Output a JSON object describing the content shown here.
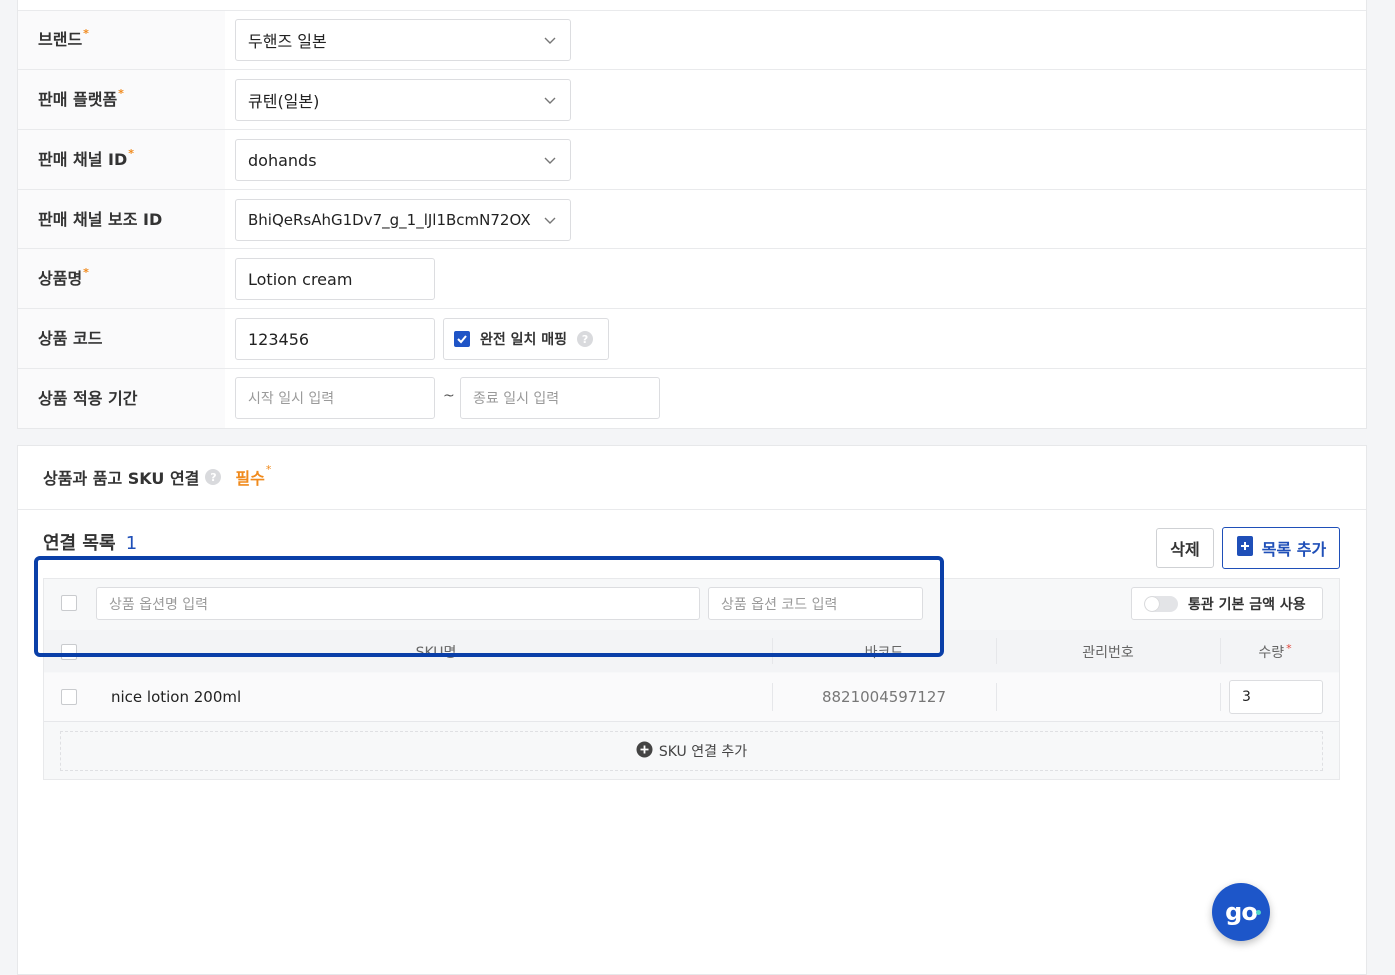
{
  "form": {
    "brand": {
      "label": "브랜드",
      "value": "두핸즈 일본"
    },
    "platform": {
      "label": "판매 플랫폼",
      "value": "큐텐(일본)"
    },
    "channel_id": {
      "label": "판매 채널 ID",
      "value": "dohands"
    },
    "channel_sub_id": {
      "label": "판매 채널 보조 ID",
      "value": "BhiQeRsAhG1Dv7_g_1_lJl1BcmN72OX"
    },
    "product_name": {
      "label": "상품명",
      "value": "Lotion cream"
    },
    "product_code": {
      "label": "상품 코드",
      "value": "123456"
    },
    "exact_match": {
      "label": "완전 일치 매핑",
      "checked": true
    },
    "period": {
      "label": "상품 적용 기간",
      "start_placeholder": "시작 일시 입력",
      "separator": "~",
      "end_placeholder": "종료 일시 입력"
    },
    "required_mark": "*"
  },
  "sku_section": {
    "title": "상품과 품고 SKU 연결",
    "required_label": "필수",
    "list_title": "연결 목록",
    "list_count": "1",
    "delete_button": "삭제",
    "add_list_button": "목록 추가",
    "option_name_placeholder": "상품 옵션명 입력",
    "option_code_placeholder": "상품 옵션 코드 입력",
    "customs_toggle_label": "통관 기본 금액 사용",
    "table": {
      "headers": {
        "sku_name": "SKU명",
        "barcode": "바코드",
        "manage_no": "관리번호",
        "qty": "수량"
      },
      "rows": [
        {
          "sku_name": "nice lotion 200ml",
          "barcode": "8821004597127",
          "manage_no": "",
          "qty": "3"
        }
      ]
    },
    "add_sku_button": "SKU 연결 추가"
  },
  "fab": {
    "label": "go"
  },
  "colors": {
    "accent": "#1f4fb8",
    "required": "#f08a1c",
    "highlight": "#0a3fa8"
  }
}
